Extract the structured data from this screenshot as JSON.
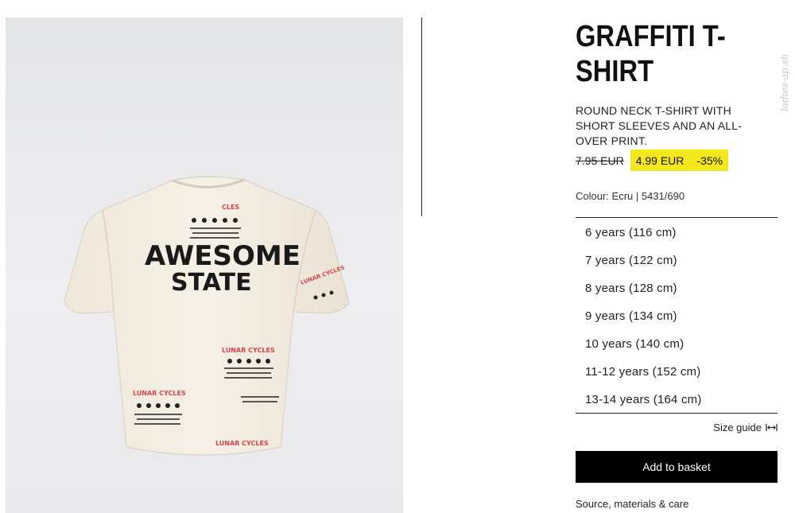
{
  "product": {
    "title": "GRAFFITI T-SHIRT",
    "description": "ROUND NECK T-SHIRT WITH SHORT SLEEVES AND AN ALL-OVER PRINT.",
    "old_price": "7.95 EUR",
    "sale_price": "4.99 EUR",
    "discount": "-35%",
    "colour": "Colour: Ecru | 5431/690"
  },
  "image": {
    "print_main_line1": "AWESOME",
    "print_main_line2": "STATE",
    "print_label": "LUNAR CYCLES"
  },
  "sizes": [
    "6 years (116 cm)",
    "7 years (122 cm)",
    "8 years (128 cm)",
    "9 years (134 cm)",
    "10 years (140 cm)",
    "11-12 years (152 cm)",
    "13-14 years (164 cm)"
  ],
  "actions": {
    "size_guide": "Size guide",
    "add_to_basket": "Add to basket",
    "source_care": "Source, materials & care"
  },
  "watermark": "ladies-ap.sh",
  "colors": {
    "sale_highlight": "#f5e71d",
    "button_bg": "#000000",
    "shirt": "#f3ece0",
    "print_red": "#d9434a"
  },
  "icons": [
    "size-guide-icon"
  ]
}
